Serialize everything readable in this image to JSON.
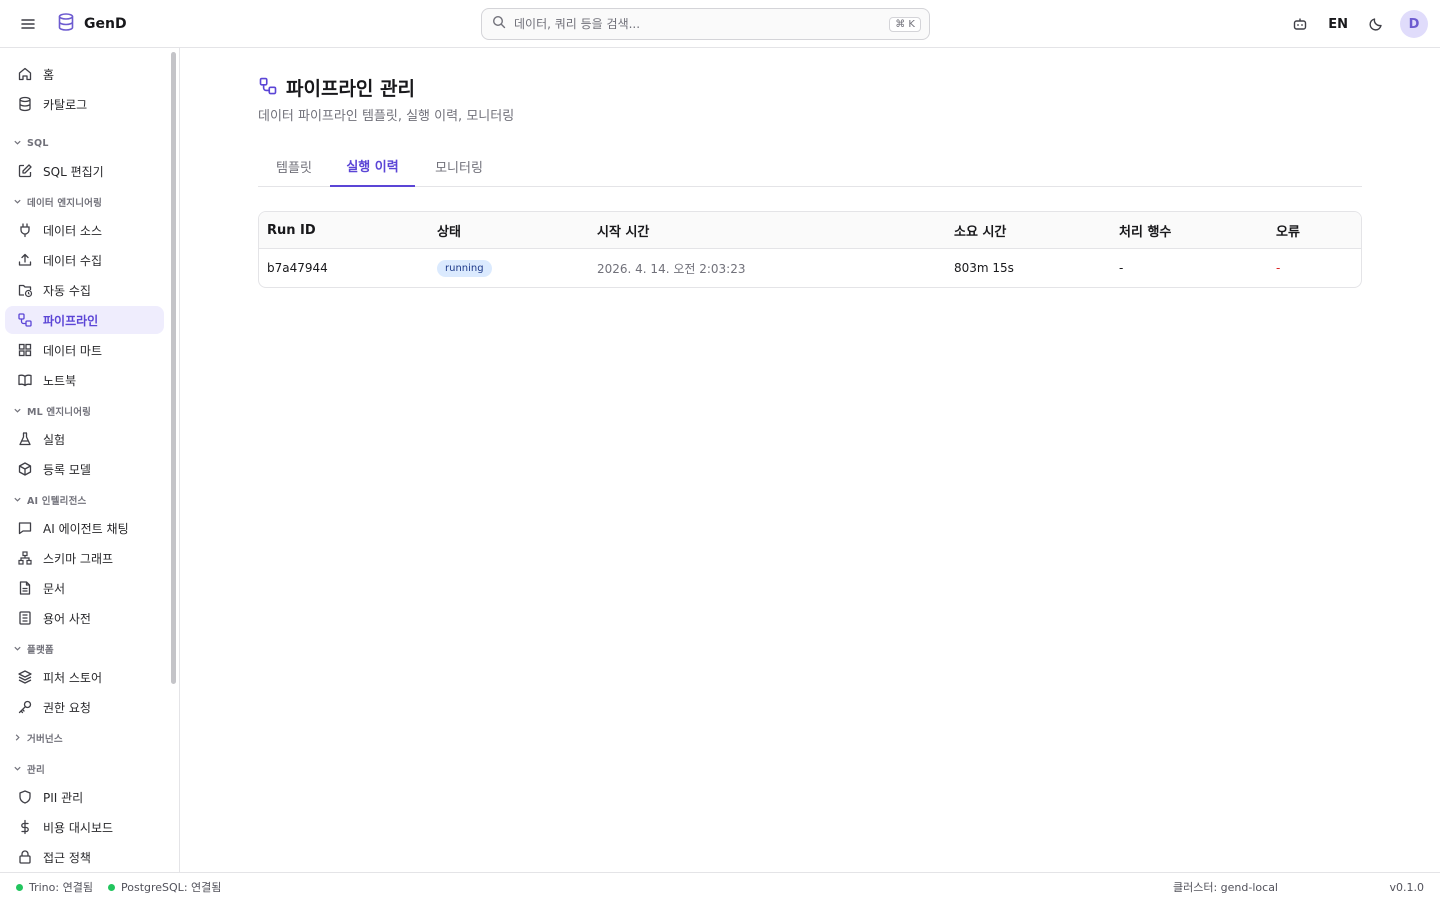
{
  "header": {
    "brand": "GenD",
    "search_placeholder": "데이터, 쿼리 등을 검색...",
    "search_shortcut": "⌘ K",
    "language": "EN",
    "avatar_initial": "D"
  },
  "sidebar": {
    "items_top": [
      {
        "label": "홈",
        "icon": "home-icon"
      },
      {
        "label": "카탈로그",
        "icon": "database-icon"
      }
    ],
    "sections": [
      {
        "label": "SQL",
        "expanded": true,
        "items": [
          {
            "label": "SQL 편집기",
            "icon": "edit-icon"
          }
        ]
      },
      {
        "label": "데이터 엔지니어링",
        "expanded": true,
        "items": [
          {
            "label": "데이터 소스",
            "icon": "plug-icon"
          },
          {
            "label": "데이터 수집",
            "icon": "upload-icon"
          },
          {
            "label": "자동 수집",
            "icon": "folder-clock-icon"
          },
          {
            "label": "파이프라인",
            "icon": "workflow-icon",
            "active": true
          },
          {
            "label": "데이터 마트",
            "icon": "grid-icon"
          },
          {
            "label": "노트북",
            "icon": "book-icon"
          }
        ]
      },
      {
        "label": "ML 엔지니어링",
        "expanded": true,
        "items": [
          {
            "label": "실험",
            "icon": "flask-icon"
          },
          {
            "label": "등록 모델",
            "icon": "box-icon"
          }
        ]
      },
      {
        "label": "AI 인텔리전스",
        "expanded": true,
        "items": [
          {
            "label": "AI 에이전트 채팅",
            "icon": "chat-icon"
          },
          {
            "label": "스키마 그래프",
            "icon": "network-icon"
          },
          {
            "label": "문서",
            "icon": "file-icon"
          },
          {
            "label": "용어 사전",
            "icon": "dictionary-icon"
          }
        ]
      },
      {
        "label": "플랫폼",
        "expanded": true,
        "items": [
          {
            "label": "피처 스토어",
            "icon": "layers-icon"
          },
          {
            "label": "권한 요청",
            "icon": "key-icon"
          }
        ]
      },
      {
        "label": "거버넌스",
        "expanded": false,
        "items": []
      },
      {
        "label": "관리",
        "expanded": true,
        "items": [
          {
            "label": "PII 관리",
            "icon": "shield-icon"
          },
          {
            "label": "비용 대시보드",
            "icon": "dollar-icon"
          },
          {
            "label": "접근 정책",
            "icon": "lock-icon"
          }
        ]
      }
    ]
  },
  "page": {
    "title": "파이프라인 관리",
    "subtitle": "데이터 파이프라인 템플릿, 실행 이력, 모니터링",
    "tabs": [
      "템플릿",
      "실행 이력",
      "모니터링"
    ],
    "active_tab": "실행 이력"
  },
  "table": {
    "columns": [
      "Run ID",
      "상태",
      "시작 시간",
      "소요 시간",
      "처리 행수",
      "오류"
    ],
    "rows": [
      {
        "run_id": "b7a47944",
        "status": "running",
        "start": "2026. 4. 14. 오전 2:03:23",
        "duration": "803m 15s",
        "rows": "-",
        "error": "-"
      }
    ]
  },
  "footer": {
    "trino": "Trino: 연결됨",
    "postgres": "PostgreSQL: 연결됨",
    "cluster": "클러스터: gend-local",
    "version": "v0.1.0",
    "status_color": "#22c55e"
  },
  "colors": {
    "accent": "#5b45d6",
    "accent_bg": "#efedfd",
    "badge_bg": "#dbeafe"
  }
}
